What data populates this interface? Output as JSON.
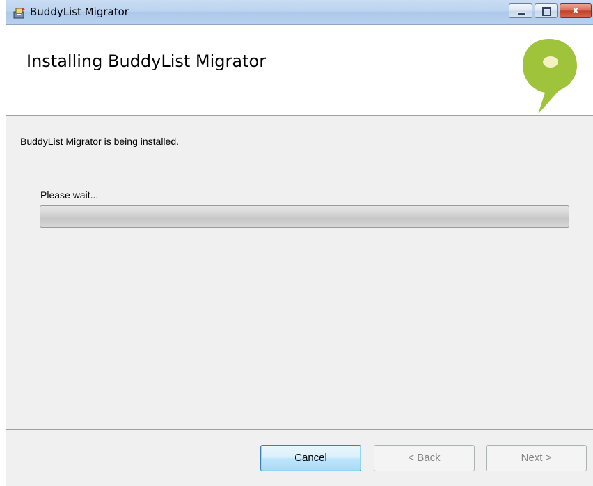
{
  "window": {
    "title": "BuddyList Migrator",
    "controls": {
      "minimize_icon": "minimize-icon",
      "maximize_icon": "maximize-icon",
      "close_label": "x"
    }
  },
  "banner": {
    "title": "Installing BuddyList Migrator",
    "logo_icon": "speech-bubble-logo",
    "logo_color": "#9fc33b"
  },
  "body": {
    "status_text": "BuddyList Migrator is being installed.",
    "wait_label": "Please wait...",
    "progress_percent": 0
  },
  "footer": {
    "cancel_label": "Cancel",
    "back_label": "< Back",
    "next_label": "Next >"
  }
}
